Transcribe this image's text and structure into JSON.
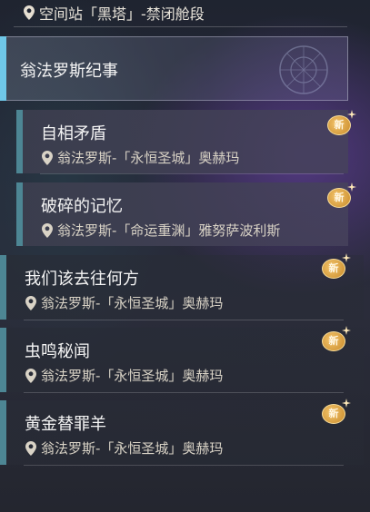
{
  "top": {
    "location": "空间站「黑塔」-禁闭舱段"
  },
  "section": {
    "title": "翁法罗斯纪事"
  },
  "sub_items": [
    {
      "title": "自相矛盾",
      "location": "翁法罗斯-「永恒圣城」奥赫玛",
      "badge": "新"
    },
    {
      "title": "破碎的记忆",
      "location": "翁法罗斯-「命运重渊」雅努萨波利斯",
      "badge": "新"
    }
  ],
  "items": [
    {
      "title": "我们该去往何方",
      "location": "翁法罗斯-「永恒圣城」奥赫玛",
      "badge": "新"
    },
    {
      "title": "虫鸣秘闻",
      "location": "翁法罗斯-「永恒圣城」奥赫玛",
      "badge": "新"
    },
    {
      "title": "黄金替罪羊",
      "location": "翁法罗斯-「永恒圣城」奥赫玛",
      "badge": "新"
    }
  ],
  "colors": {
    "accent": "#6fc7e8",
    "bar": "#4d8694",
    "badge": "#e0a548"
  }
}
